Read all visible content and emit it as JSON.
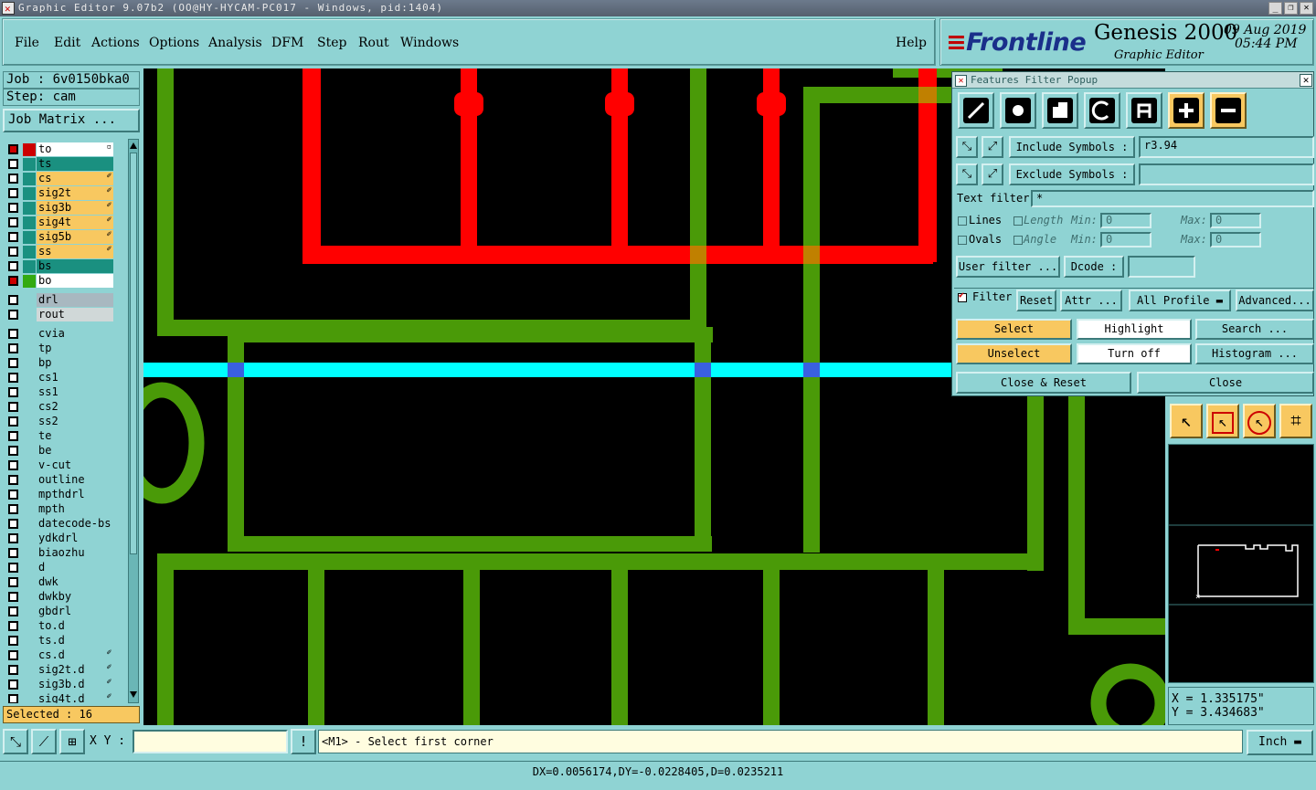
{
  "window": {
    "title": "Graphic Editor 9.07b2 (OO@HY-HYCAM-PC017 - Windows, pid:1404)"
  },
  "menubar": {
    "items": [
      "File",
      "Edit",
      "Actions",
      "Options",
      "Analysis",
      "DFM",
      "Step",
      "Rout",
      "Windows"
    ],
    "help": "Help"
  },
  "brand": {
    "logo": "Frontline",
    "product": "Genesis 2000",
    "subtitle": "Graphic Editor",
    "date": "09 Aug 2019",
    "time": "05:44 PM"
  },
  "left": {
    "job": "Job : 6v0150bka0",
    "step": "Step: cam",
    "job_matrix": "Job Matrix ...",
    "layers": [
      {
        "name": "to",
        "bg": "#ffffff",
        "cb": "red",
        "color": "#cc0000",
        "mark": "▫"
      },
      {
        "name": "ts",
        "bg": "#1a9080",
        "cb": "white",
        "color": "#1a9080",
        "mark": ""
      },
      {
        "name": "cs",
        "bg": "#f8c860",
        "cb": "white",
        "color": "#1a9080",
        "mark": "✐"
      },
      {
        "name": "sig2t",
        "bg": "#f8c860",
        "cb": "white",
        "color": "#1a9080",
        "mark": "✐"
      },
      {
        "name": "sig3b",
        "bg": "#f8c860",
        "cb": "white",
        "color": "#1a9080",
        "mark": "✐"
      },
      {
        "name": "sig4t",
        "bg": "#f8c860",
        "cb": "white",
        "color": "#1a9080",
        "mark": "✐"
      },
      {
        "name": "sig5b",
        "bg": "#f8c860",
        "cb": "white",
        "color": "#1a9080",
        "mark": "✐"
      },
      {
        "name": "ss",
        "bg": "#f8c860",
        "cb": "white",
        "color": "#1a9080",
        "mark": "✐"
      },
      {
        "name": "bs",
        "bg": "#1a9080",
        "cb": "white",
        "color": "#1a9080",
        "mark": ""
      },
      {
        "name": "bo",
        "bg": "#ffffff",
        "cb": "red",
        "color": "#33aa11",
        "mark": ""
      },
      {
        "name": "drl",
        "bg": "#a8b8c0",
        "cb": "white",
        "color": "#8fd3d3",
        "mark": ""
      },
      {
        "name": "rout",
        "bg": "#d0d8d8",
        "cb": "white",
        "color": "#8fd3d3",
        "mark": ""
      },
      {
        "name": "cvia",
        "bg": "#8fd3d3",
        "cb": "white",
        "color": "#8fd3d3",
        "mark": ""
      },
      {
        "name": "tp",
        "bg": "#8fd3d3",
        "cb": "white",
        "color": "#8fd3d3",
        "mark": ""
      },
      {
        "name": "bp",
        "bg": "#8fd3d3",
        "cb": "white",
        "color": "#8fd3d3",
        "mark": ""
      },
      {
        "name": "cs1",
        "bg": "#8fd3d3",
        "cb": "white",
        "color": "#8fd3d3",
        "mark": ""
      },
      {
        "name": "ss1",
        "bg": "#8fd3d3",
        "cb": "white",
        "color": "#8fd3d3",
        "mark": ""
      },
      {
        "name": "cs2",
        "bg": "#8fd3d3",
        "cb": "white",
        "color": "#8fd3d3",
        "mark": ""
      },
      {
        "name": "ss2",
        "bg": "#8fd3d3",
        "cb": "white",
        "color": "#8fd3d3",
        "mark": ""
      },
      {
        "name": "te",
        "bg": "#8fd3d3",
        "cb": "white",
        "color": "#8fd3d3",
        "mark": ""
      },
      {
        "name": "be",
        "bg": "#8fd3d3",
        "cb": "white",
        "color": "#8fd3d3",
        "mark": ""
      },
      {
        "name": "v-cut",
        "bg": "#8fd3d3",
        "cb": "white",
        "color": "#8fd3d3",
        "mark": ""
      },
      {
        "name": "outline",
        "bg": "#8fd3d3",
        "cb": "white",
        "color": "#8fd3d3",
        "mark": ""
      },
      {
        "name": "mpthdrl",
        "bg": "#8fd3d3",
        "cb": "white",
        "color": "#8fd3d3",
        "mark": ""
      },
      {
        "name": "mpth",
        "bg": "#8fd3d3",
        "cb": "white",
        "color": "#8fd3d3",
        "mark": ""
      },
      {
        "name": "datecode-bs",
        "bg": "#8fd3d3",
        "cb": "white",
        "color": "#8fd3d3",
        "mark": ""
      },
      {
        "name": "ydkdrl",
        "bg": "#8fd3d3",
        "cb": "white",
        "color": "#8fd3d3",
        "mark": ""
      },
      {
        "name": "biaozhu",
        "bg": "#8fd3d3",
        "cb": "white",
        "color": "#8fd3d3",
        "mark": ""
      },
      {
        "name": "d",
        "bg": "#8fd3d3",
        "cb": "white",
        "color": "#8fd3d3",
        "mark": ""
      },
      {
        "name": "dwk",
        "bg": "#8fd3d3",
        "cb": "white",
        "color": "#8fd3d3",
        "mark": ""
      },
      {
        "name": "dwkby",
        "bg": "#8fd3d3",
        "cb": "white",
        "color": "#8fd3d3",
        "mark": ""
      },
      {
        "name": "gbdrl",
        "bg": "#8fd3d3",
        "cb": "white",
        "color": "#8fd3d3",
        "mark": ""
      },
      {
        "name": "to.d",
        "bg": "#8fd3d3",
        "cb": "white",
        "color": "#8fd3d3",
        "mark": ""
      },
      {
        "name": "ts.d",
        "bg": "#8fd3d3",
        "cb": "white",
        "color": "#8fd3d3",
        "mark": ""
      },
      {
        "name": "cs.d",
        "bg": "#8fd3d3",
        "cb": "white",
        "color": "#8fd3d3",
        "mark": "✐"
      },
      {
        "name": "sig2t.d",
        "bg": "#8fd3d3",
        "cb": "white",
        "color": "#8fd3d3",
        "mark": "✐"
      },
      {
        "name": "sig3b.d",
        "bg": "#8fd3d3",
        "cb": "white",
        "color": "#8fd3d3",
        "mark": "✐"
      },
      {
        "name": "sig4t.d",
        "bg": "#8fd3d3",
        "cb": "white",
        "color": "#8fd3d3",
        "mark": "✐"
      }
    ],
    "selected": "Selected : 16"
  },
  "popup": {
    "title": "Features Filter Popup",
    "include_label": "Include Symbols :",
    "include_value": "r3.94",
    "exclude_label": "Exclude Symbols :",
    "exclude_value": "",
    "text_filter_label": "Text filter",
    "text_filter_value": "*",
    "lines": "Lines",
    "ovals": "Ovals",
    "length": "Length",
    "angle": "Angle",
    "min": "Min:",
    "max": "Max:",
    "len_min": "0",
    "len_max": "0",
    "ang_min": "0",
    "ang_max": "0",
    "user_filter": "User filter ...",
    "dcode": "Dcode :",
    "dcode_value": "",
    "filter": "Filter",
    "reset": "Reset",
    "attr": "Attr ...",
    "all_profile": "All Profile",
    "advanced": "Advanced...",
    "select": "Select",
    "highlight": "Highlight",
    "search": "Search ...",
    "unselect": "Unselect",
    "turn_off": "Turn off",
    "histogram": "Histogram ...",
    "close_reset": "Close & Reset",
    "close": "Close"
  },
  "coords": {
    "x": "X = 1.335175\"",
    "y": "Y = 3.434683\""
  },
  "bottom": {
    "xy_label": "X Y :",
    "xy_value": "",
    "prompt": "<M1> - Select first corner",
    "units": "Inch"
  },
  "status": {
    "text": "DX=0.0056174,DY=-0.0228405,D=0.0235211"
  },
  "colors": {
    "copper_green": "#4a9a08",
    "selected_red": "#ff0000",
    "highlight_cyan": "#00ffff",
    "panel_bg": "#8fd3d3",
    "button_orange": "#f8c860"
  }
}
